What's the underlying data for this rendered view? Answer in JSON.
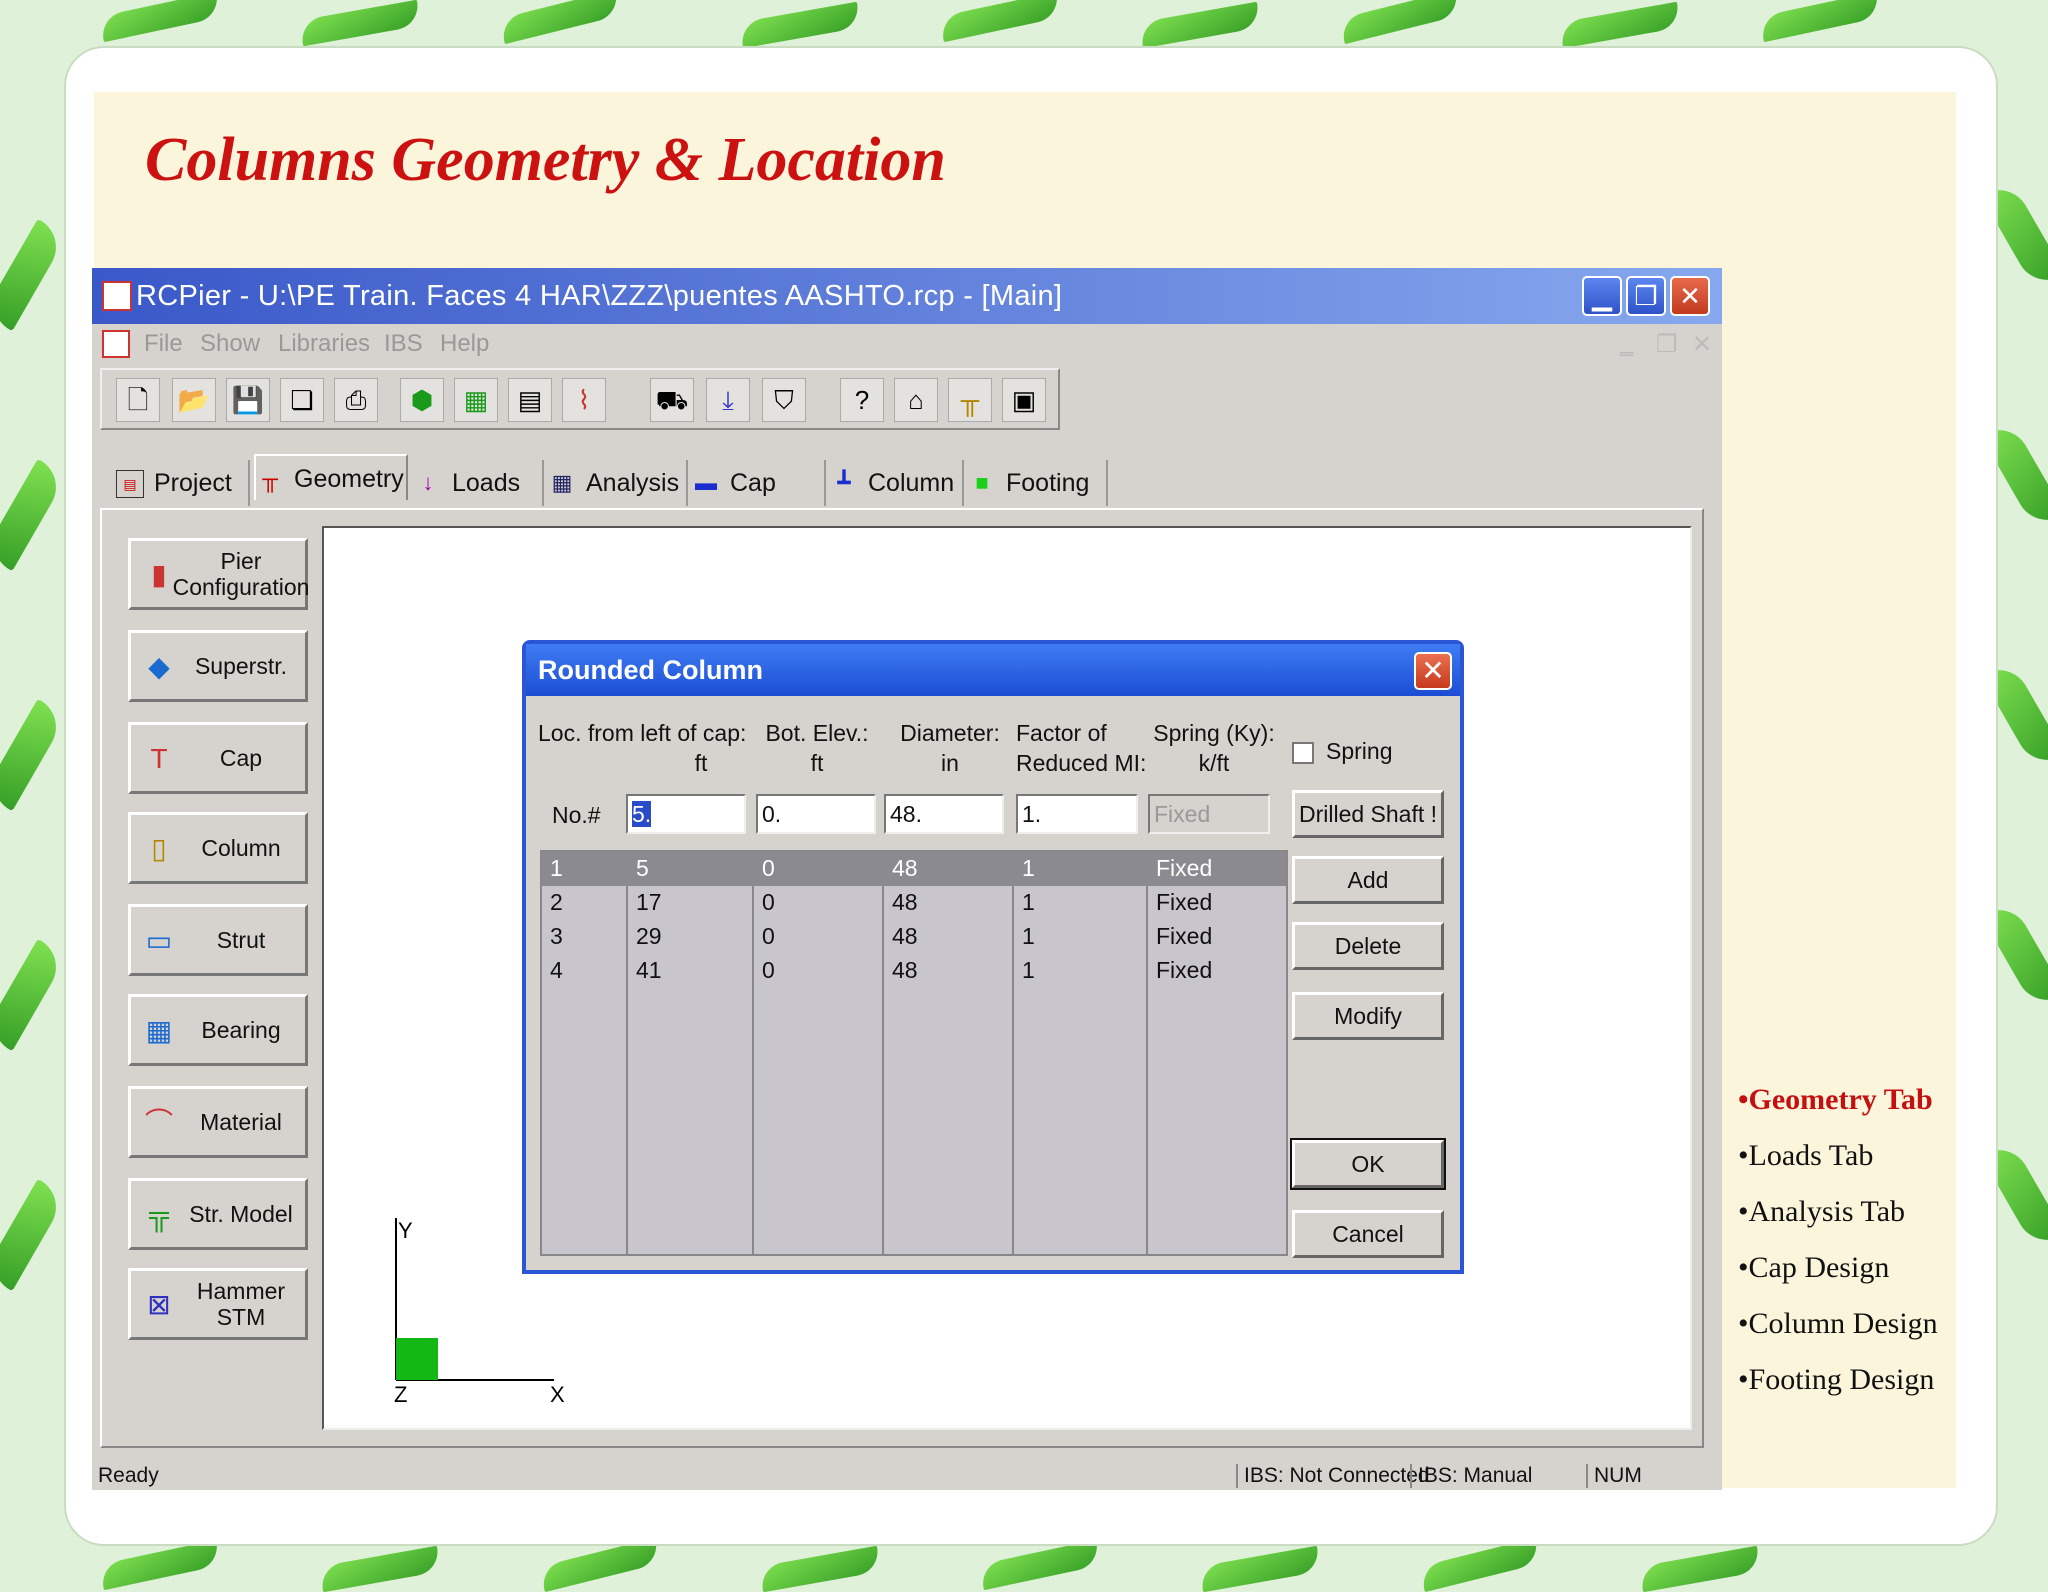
{
  "slide": {
    "title": "Columns Geometry & Location",
    "bullets": [
      {
        "label": "•Geometry Tab",
        "active": true
      },
      {
        "label": "•Loads Tab",
        "active": false
      },
      {
        "label": "•Analysis Tab",
        "active": false
      },
      {
        "label": "•Cap Design",
        "active": false
      },
      {
        "label": "•Column Design",
        "active": false
      },
      {
        "label": "•Footing Design",
        "active": false
      }
    ]
  },
  "window": {
    "title": "RCPier - U:\\PE Train. Faces 4 HAR\\ZZZ\\puentes AASHTO.rcp - [Main]",
    "menu": [
      "File",
      "Show",
      "Libraries",
      "IBS",
      "Help"
    ],
    "toolbar_icons": [
      "new-icon",
      "open-icon",
      "save-icon",
      "copy-icon",
      "print-icon",
      "3d-view-icon",
      "grid-icon",
      "report-icon",
      "chart-icon",
      "truck-icon",
      "load-icon",
      "stamp-icon",
      "help-icon",
      "home-icon",
      "bridge-icon",
      "image-icon"
    ],
    "tabs": [
      {
        "label": "Project",
        "icon": "doc-icon",
        "glyph": "▤"
      },
      {
        "label": "Geometry",
        "icon": "frame-icon",
        "glyph": "╥"
      },
      {
        "label": "Loads",
        "icon": "arrow-down-icon",
        "glyph": "↓"
      },
      {
        "label": "Analysis",
        "icon": "grid-icon",
        "glyph": "▦"
      },
      {
        "label": "Cap",
        "icon": "cap-icon",
        "glyph": "▬"
      },
      {
        "label": "Column",
        "icon": "column-icon",
        "glyph": "┃"
      },
      {
        "label": "Footing",
        "icon": "footing-icon",
        "glyph": "■"
      }
    ],
    "active_tab": "Geometry",
    "sidebar": [
      {
        "label": "Pier Configuration",
        "icon": "pier-icon",
        "glyph": "▮"
      },
      {
        "label": "Superstr.",
        "icon": "cube-icon",
        "glyph": "◆"
      },
      {
        "label": "Cap",
        "icon": "hammer-icon",
        "glyph": "T"
      },
      {
        "label": "Column",
        "icon": "column-icon",
        "glyph": "▯"
      },
      {
        "label": "Strut",
        "icon": "strut-icon",
        "glyph": "▭"
      },
      {
        "label": "Bearing",
        "icon": "bearing-icon",
        "glyph": "▦"
      },
      {
        "label": "Material",
        "icon": "material-icon",
        "glyph": "⌒"
      },
      {
        "label": "Str. Model",
        "icon": "frame-icon",
        "glyph": "╦"
      },
      {
        "label": "Hammer STM",
        "icon": "stm-icon",
        "glyph": "⊠"
      }
    ],
    "axes": {
      "y": "Y",
      "z": "Z",
      "x": "X"
    },
    "status": {
      "ready": "Ready",
      "ibs_connection": "IBS: Not Connected",
      "ibs_mode": "IBS: Manual",
      "num": "NUM"
    }
  },
  "dialog": {
    "title": "Rounded Column",
    "headers": {
      "loc": [
        "Loc. from left of cap:",
        "ft"
      ],
      "bot": [
        "Bot. Elev.:",
        "ft"
      ],
      "dia": [
        "Diameter:",
        "in"
      ],
      "factor": [
        "Factor of",
        "Reduced MI:"
      ],
      "spring": [
        "Spring (Ky):",
        "k/ft"
      ]
    },
    "row_label": "No.#",
    "inputs": {
      "loc": "5.",
      "bot": "0.",
      "dia": "48.",
      "factor": "1.",
      "spring": "Fixed"
    },
    "spring_checkbox_label": "Spring",
    "spring_checked": false,
    "rows": [
      {
        "no": "1",
        "loc": "5",
        "bot": "0",
        "dia": "48",
        "factor": "1",
        "spring": "Fixed",
        "selected": true
      },
      {
        "no": "2",
        "loc": "17",
        "bot": "0",
        "dia": "48",
        "factor": "1",
        "spring": "Fixed",
        "selected": false
      },
      {
        "no": "3",
        "loc": "29",
        "bot": "0",
        "dia": "48",
        "factor": "1",
        "spring": "Fixed",
        "selected": false
      },
      {
        "no": "4",
        "loc": "41",
        "bot": "0",
        "dia": "48",
        "factor": "1",
        "spring": "Fixed",
        "selected": false
      }
    ],
    "buttons": {
      "drilled_shaft": "Drilled Shaft !",
      "add": "Add",
      "delete": "Delete",
      "modify": "Modify",
      "ok": "OK",
      "cancel": "Cancel"
    }
  }
}
